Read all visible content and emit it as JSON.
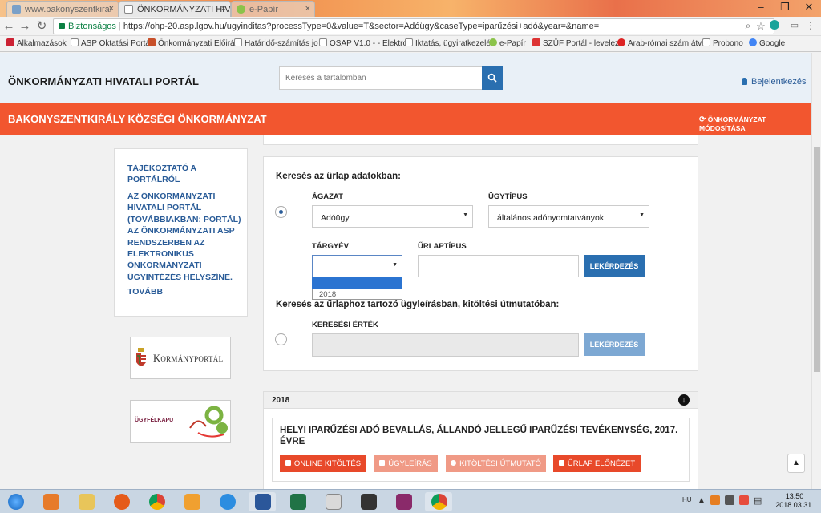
{
  "browser": {
    "tabs": [
      {
        "title": "www.bakonyszentkirál",
        "active": false
      },
      {
        "title": "ÖNKORMÁNYZATI HIVA",
        "active": true
      },
      {
        "title": "e-Papír",
        "active": false
      }
    ],
    "security_label": "Biztonságos",
    "url": "https://ohp-20.asp.lgov.hu/ugyinditas?processType=0&value=T&sector=Adóügy&caseType=iparűzési+adó&year=&name=",
    "bookmarks": [
      "Alkalmazások",
      "ASP Oktatási Portál",
      "Önkormányzati Előirá",
      "Határidő-számítás jo",
      "OSAP V1.0 - - Elektro",
      "Iktatás, ügyiratkezelé",
      "e-Papír",
      "SZÜF Portál - levelez",
      "Arab-római szám átv",
      "Probono",
      "Google"
    ]
  },
  "header": {
    "portal_title": "ÖNKORMÁNYZATI HIVATALI PORTÁL",
    "search_placeholder": "Keresés a tartalomban",
    "login_label": "Bejelentkezés"
  },
  "municipality_bar": {
    "name": "BAKONYSZENTKIRÁLY KÖZSÉGI ÖNKORMÁNYZAT",
    "change_label": "ÖNKORMÁNYZAT MÓDOSÍTÁSA"
  },
  "sidebar": {
    "info_title": "TÁJÉKOZTATÓ A PORTÁLRÓL",
    "info_text": "AZ ÖNKORMÁNYZATI HIVATALI PORTÁL (TOVÁBBIAKBAN: PORTÁL) AZ ÖNKORMÁNYZATI ASP RENDSZERBEN AZ ELEKTRONIKUS ÖNKORMÁNYZATI ÜGYINTÉZÉS HELYSZÍNE.",
    "more_link": "TOVÁBB",
    "kormanyportal": "Kormányportál",
    "ugyfelkapu": "ÜGYFÉLKAPU"
  },
  "form_search": {
    "heading": "Keresés az űrlap adatokban:",
    "agazat_label": "ÁGAZAT",
    "agazat_value": "Adóügy",
    "ugytipus_label": "ÜGYTÍPUS",
    "ugytipus_value": "általános adónyomtatványok",
    "targyev_label": "TÁRGYÉV",
    "targyev_value": "",
    "targyev_options": [
      "",
      "2018"
    ],
    "urlaptipus_label": "ŰRLAPTÍPUS",
    "urlaptipus_value": "",
    "query_button": "LEKÉRDEZÉS",
    "selected": true
  },
  "desc_search": {
    "heading": "Keresés az űrlaphoz tartozó ügyleírásban, kitöltési útmutatóban:",
    "keresesi_label": "KERESÉSI ÉRTÉK",
    "keresesi_value": "",
    "query_button": "LEKÉRDEZÉS",
    "selected": false
  },
  "results": {
    "year": "2018",
    "form_title": "HELYI IPARŰZÉSI ADÓ BEVALLÁS, ÁLLANDÓ JELLEGŰ IPARŰZÉSI TEVÉKENYSÉG, 2017. ÉVRE",
    "actions": [
      {
        "label": "ONLINE KITÖLTÉS",
        "color": "#e8492a"
      },
      {
        "label": "ÜGYLEÍRÁS",
        "color": "#f09a86"
      },
      {
        "label": "KITÖLTÉSI ÚTMUTATÓ",
        "color": "#f09a86"
      },
      {
        "label": "ŰRLAP ELŐNÉZET",
        "color": "#e8492a"
      }
    ]
  },
  "taskbar": {
    "language": "HU",
    "time": "13:50",
    "date": "2018.03.31."
  },
  "colors": {
    "accent_orange": "#f2562f",
    "primary_blue": "#2a6fb0",
    "link_blue": "#2a5c98"
  }
}
